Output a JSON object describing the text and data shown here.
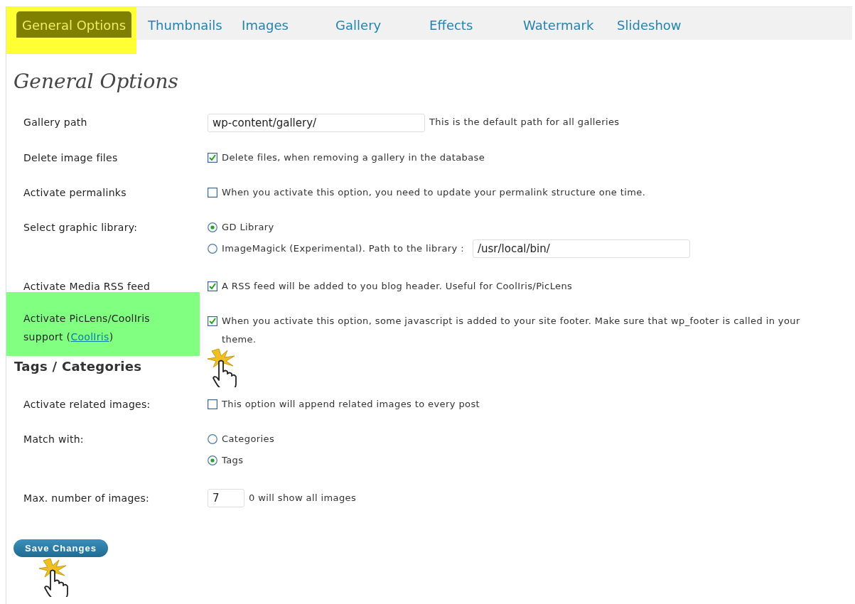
{
  "tabs": [
    {
      "label": "General Options",
      "selected": true,
      "highlighted": true
    },
    {
      "label": "Thumbnails",
      "selected": false,
      "highlighted": false
    },
    {
      "label": "Images",
      "selected": false,
      "highlighted": false
    },
    {
      "label": "Gallery",
      "selected": false,
      "highlighted": false
    },
    {
      "label": "Effects",
      "selected": false,
      "highlighted": false
    },
    {
      "label": "Watermark",
      "selected": false,
      "highlighted": false
    },
    {
      "label": "Slideshow",
      "selected": false,
      "highlighted": false
    }
  ],
  "title": "General Options",
  "sections": [
    {
      "rows": [
        {
          "kind": "text",
          "label": "Gallery path",
          "value": "wp-content/gallery/",
          "note": "This is the default path for all galleries",
          "highlighted": false
        },
        {
          "kind": "checkbox",
          "label": "Delete image files",
          "checked": true,
          "text": "Delete files, when removing a gallery in the database",
          "highlighted": false
        },
        {
          "kind": "checkbox",
          "label": "Activate permalinks",
          "checked": false,
          "text": "When you activate this option, you need to update your permalink structure one time.",
          "highlighted": false
        },
        {
          "kind": "radio",
          "label": "Select graphic library:",
          "options": [
            {
              "label": "GD Library",
              "selected": true
            },
            {
              "label": "ImageMagick (Experimental). Path to the library :",
              "selected": false,
              "value": "/usr/local/bin/"
            }
          ],
          "highlighted": false
        },
        {
          "kind": "checkbox",
          "label": "Activate Media RSS feed",
          "checked": true,
          "text": "A RSS feed will be added to you blog header. Useful for CoolIris/PicLens",
          "highlighted": false
        },
        {
          "kind": "checkbox",
          "label": "Activate PicLens/CoolIris support (",
          "link": "CoolIris",
          "label_end": ")",
          "checked": true,
          "text": "When you activate this option, some javascript is added to your site footer. Make sure that wp_footer is called in your theme.",
          "highlighted": true,
          "cursor": true
        }
      ]
    },
    {
      "heading": "Tags / Categories",
      "rows": [
        {
          "kind": "checkbox",
          "label": "Activate related images:",
          "checked": false,
          "text": "This option will append related images to every post",
          "highlighted": false
        },
        {
          "kind": "radio",
          "label": "Match with:",
          "options": [
            {
              "label": "Categories",
              "selected": false
            },
            {
              "label": "Tags",
              "selected": true
            }
          ],
          "highlighted": false
        },
        {
          "kind": "number",
          "label": "Max. number of images:",
          "value": "7",
          "note": "0 will show all images",
          "highlighted": false
        }
      ]
    }
  ],
  "save_button": {
    "label": "Save Changes",
    "cursor": true
  }
}
